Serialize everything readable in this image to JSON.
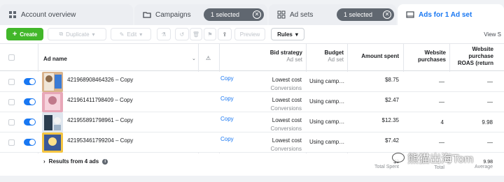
{
  "tabs": {
    "account_overview": "Account overview",
    "campaigns": "Campaigns",
    "campaigns_selected": "1 selected",
    "ad_sets": "Ad sets",
    "ad_sets_selected": "1 selected",
    "ads_for": "Ads for 1 Ad set"
  },
  "toolbar": {
    "create": "Create",
    "duplicate": "Duplicate",
    "edit": "Edit",
    "preview": "Preview",
    "rules": "Rules",
    "view_setup": "View S"
  },
  "columns": {
    "ad_name": "Ad name",
    "bid_strategy": "Bid strategy",
    "bid_strategy_sub": "Ad set",
    "budget": "Budget",
    "budget_sub": "Ad set",
    "amount_spent": "Amount spent",
    "website_purchases": [
      "Website",
      "purchases"
    ],
    "website_roas": [
      "Website",
      "purchase",
      "ROAS (return"
    ]
  },
  "rows": [
    {
      "name": "421968908464326 – Copy",
      "edit": "Copy",
      "bid": "Lowest cost",
      "bid_sub": "Conversions",
      "budget": "Using camp…",
      "spent": "$8.75",
      "purchases": "—",
      "roas": "—"
    },
    {
      "name": "421961411798409 – Copy",
      "edit": "Copy",
      "bid": "Lowest cost",
      "bid_sub": "Conversions",
      "budget": "Using camp…",
      "spent": "$2.47",
      "purchases": "—",
      "roas": "—"
    },
    {
      "name": "421955891798961 – Copy",
      "edit": "Copy",
      "bid": "Lowest cost",
      "bid_sub": "Conversions",
      "budget": "Using camp…",
      "spent": "$12.35",
      "purchases": "4",
      "roas": "9.98"
    },
    {
      "name": "421953461799204 – Copy",
      "edit": "Copy",
      "bid": "Lowest cost",
      "bid_sub": "Conversions",
      "budget": "Using camp…",
      "spent": "$7.42",
      "purchases": "—",
      "roas": "—"
    }
  ],
  "footer": {
    "results": "Results from 4 ads",
    "spent_value": "$3",
    "spent_label": "Total Spent",
    "purchases_label": "Total",
    "roas_value": "9.98",
    "roas_label": "Average"
  },
  "watermark": "熊猫出海Tom",
  "colors": {
    "accent": "#1877f2",
    "create": "#42b72a",
    "pill": "#606770"
  }
}
